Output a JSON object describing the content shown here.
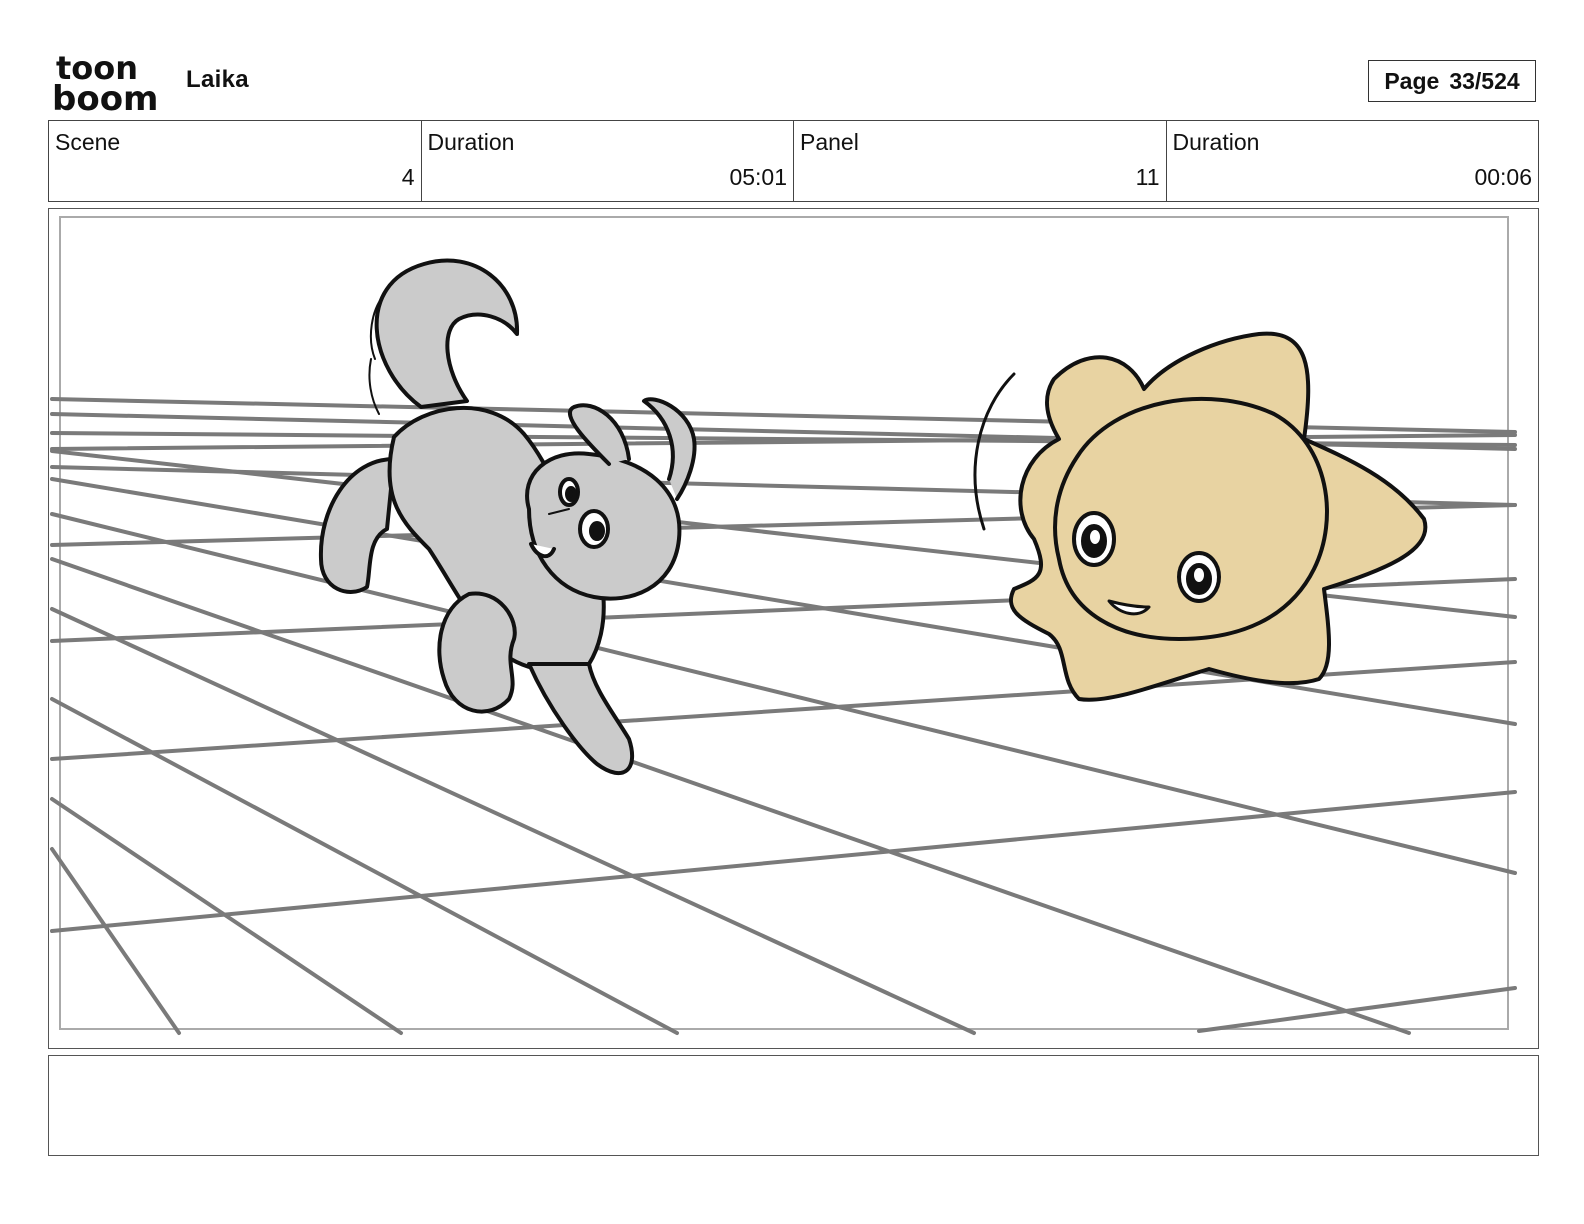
{
  "header": {
    "project_name": "Laika",
    "page_label": "Page",
    "page_value": "33/524"
  },
  "logo": {
    "line1": "toon",
    "line2": "boom",
    "icon": "toon-boom-logo"
  },
  "info": {
    "scene_label": "Scene",
    "scene_value": "4",
    "scene_duration_label": "Duration",
    "scene_duration_value": "05:01",
    "panel_label": "Panel",
    "panel_value": "11",
    "panel_duration_label": "Duration",
    "panel_duration_value": "00:06"
  },
  "colors": {
    "dog_fill": "#cbcbcb",
    "star_fill": "#e8d3a2",
    "grid_line": "#7a7a7a",
    "ink": "#111111"
  }
}
